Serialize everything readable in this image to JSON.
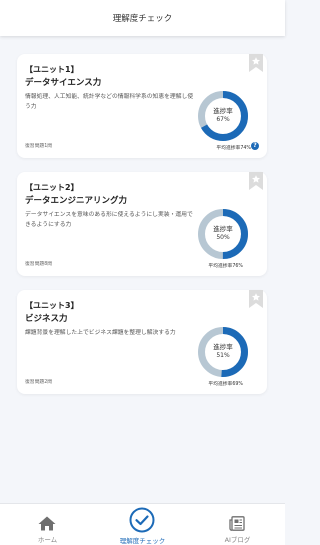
{
  "header": {
    "title": "理解度チェック"
  },
  "colors": {
    "accent": "#1c6ab7",
    "track": "#b7c7d3",
    "bookmark": "#dcdcdc"
  },
  "units": [
    {
      "unit": "【ユニット1】",
      "name": "データサイエンス力",
      "description": "情報処理、人工知能、統計学などの情報科学系の知恵を理解し使う力",
      "review": "復習問題1問",
      "progress_label": "進捗率",
      "progress_text": "67%",
      "progress": 0.67,
      "average": "平均進捗率74%",
      "help_icon": "question-icon"
    },
    {
      "unit": "【ユニット2】",
      "name": "データエンジニアリング力",
      "description": "データサイエンスを意味のある形に使えるようにし実装・運用できるようにする力",
      "review": "復習問題8問",
      "progress_label": "進捗率",
      "progress_text": "50%",
      "progress": 0.5,
      "average": "平均進捗率76%"
    },
    {
      "unit": "【ユニット3】",
      "name": "ビジネス力",
      "description": "課題背景を理解した上でビジネス課題を整理し解決する力",
      "review": "復習問題2問",
      "progress_label": "進捗率",
      "progress_text": "51%",
      "progress": 0.51,
      "average": "平均進捗率69%"
    }
  ],
  "tabbar": {
    "tabs": [
      {
        "label": "ホーム",
        "icon": "home-icon",
        "active": false
      },
      {
        "label": "理解度チェック",
        "icon": "check-circle-icon",
        "active": true
      },
      {
        "label": "AIブログ",
        "icon": "blog-icon",
        "active": false
      }
    ]
  }
}
